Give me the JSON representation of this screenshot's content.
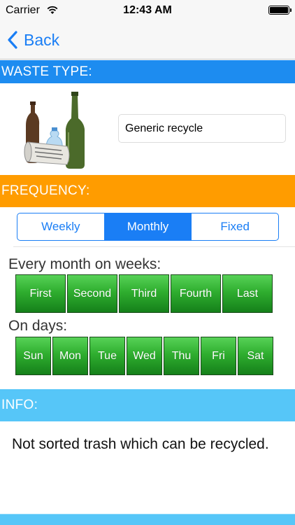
{
  "status_bar": {
    "carrier": "Carrier",
    "time": "12:43 AM",
    "wifi_icon": "wifi-icon",
    "battery_icon": "battery-icon"
  },
  "nav": {
    "back_label": "Back",
    "back_icon": "chevron-left-icon"
  },
  "waste_type": {
    "header": "WASTE TYPE:",
    "image": "recycle-bottles-newspaper-image",
    "value": "Generic recycle"
  },
  "frequency": {
    "header": "FREQUENCY:",
    "options": [
      "Weekly",
      "Monthly",
      "Fixed"
    ],
    "selected": "Monthly",
    "weeks_label": "Every month on weeks:",
    "weeks": [
      "First",
      "Second",
      "Third",
      "Fourth",
      "Last"
    ],
    "days_label": "On days:",
    "days": [
      "Sun",
      "Mon",
      "Tue",
      "Wed",
      "Thu",
      "Fri",
      "Sat"
    ]
  },
  "info": {
    "header": "INFO:",
    "text": "Not sorted trash which can be recycled."
  },
  "colors": {
    "accent": "#1a7ef5",
    "waste_header": "#1d8cf0",
    "frequency_header": "#ff9c00",
    "info_header": "#56c6f8",
    "day_button": "#2fae2f"
  }
}
